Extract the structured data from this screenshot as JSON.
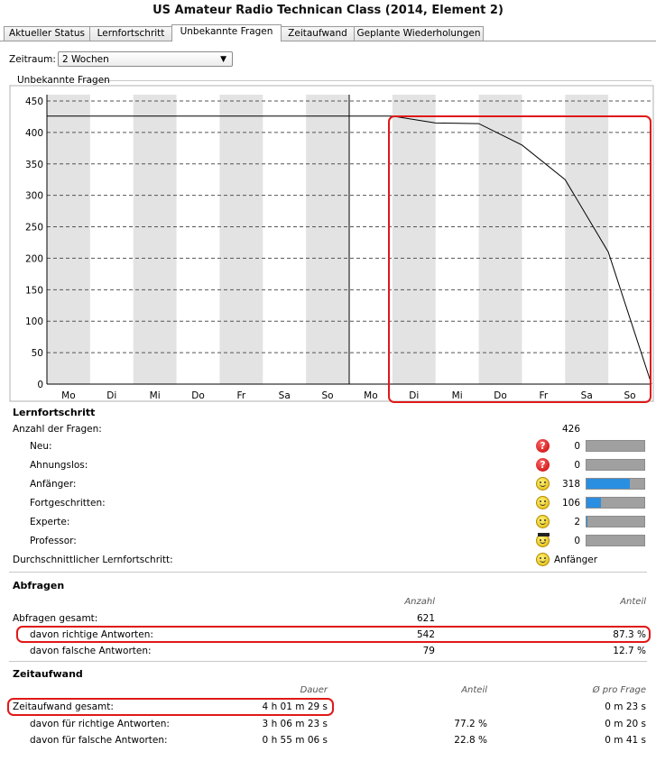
{
  "window_title": "US Amateur Radio Technican Class (2014, Element 2)",
  "tabs": [
    "Aktueller Status",
    "Lernfortschritt",
    "Unbekannte Fragen",
    "Zeitaufwand",
    "Geplante Wiederholungen"
  ],
  "active_tab": "Unbekannte Fragen",
  "period": {
    "label": "Zeitraum:",
    "value": "2 Wochen"
  },
  "chart_group_label": "Unbekannte Fragen",
  "chart_data": {
    "type": "line",
    "categories": [
      "Mo",
      "Di",
      "Mi",
      "Do",
      "Fr",
      "Sa",
      "So",
      "Mo",
      "Di",
      "Mi",
      "Do",
      "Fr",
      "Sa",
      "So"
    ],
    "x": [
      0,
      1,
      2,
      3,
      4,
      5,
      6,
      7,
      8,
      9,
      10,
      11,
      12,
      13,
      14
    ],
    "values": [
      426,
      426,
      426,
      426,
      426,
      426,
      426,
      426,
      426,
      415,
      414,
      380,
      325,
      210,
      0
    ],
    "y_ticks": [
      0,
      50,
      100,
      150,
      200,
      250,
      300,
      350,
      400,
      450
    ],
    "ylim": [
      0,
      460
    ],
    "grid": true,
    "title": "",
    "xlabel": "",
    "ylabel": ""
  },
  "lernfortschritt": {
    "header": "Lernfortschritt",
    "total_label": "Anzahl der Fragen:",
    "total": "426",
    "levels": [
      {
        "label": "Neu:",
        "icon": "red-question-icon",
        "count": "0",
        "fraction": 0
      },
      {
        "label": "Ahnungslos:",
        "icon": "red-question-smiley-icon",
        "count": "0",
        "fraction": 0
      },
      {
        "label": "Anfänger:",
        "icon": "yellow-smiley-icon",
        "count": "318",
        "fraction": 0.746
      },
      {
        "label": "Fortgeschritten:",
        "icon": "yellow-smiley-icon",
        "count": "106",
        "fraction": 0.249
      },
      {
        "label": "Experte:",
        "icon": "yellow-smiley-icon",
        "count": "2",
        "fraction": 0.005
      },
      {
        "label": "Professor:",
        "icon": "graduate-smiley-icon",
        "count": "0",
        "fraction": 0
      }
    ],
    "average_label": "Durchschnittlicher Lernfortschritt:",
    "average_value": "Anfänger"
  },
  "abfragen": {
    "header": "Abfragen",
    "col_count": "Anzahl",
    "col_share": "Anteil",
    "rows": [
      {
        "label": "Abfragen gesamt:",
        "count": "621",
        "share": ""
      },
      {
        "label": "davon richtige Antworten:",
        "count": "542",
        "share": "87.3 %"
      },
      {
        "label": "davon falsche Antworten:",
        "count": "79",
        "share": "12.7 %"
      }
    ]
  },
  "zeitaufwand": {
    "header": "Zeitaufwand",
    "col_duration": "Dauer",
    "col_share": "Anteil",
    "col_per_question": "Ø pro Frage",
    "rows": [
      {
        "label": "Zeitaufwand gesamt:",
        "duration": "4 h 01 m 29 s",
        "share": "",
        "per_question": "0 m 23 s"
      },
      {
        "label": "davon für richtige Antworten:",
        "duration": "3 h 06 m 23 s",
        "share": "77.2 %",
        "per_question": "0 m 20 s"
      },
      {
        "label": "davon für falsche Antworten:",
        "duration": "0 h 55 m 06 s",
        "share": "22.8 %",
        "per_question": "0 m 41 s"
      }
    ]
  },
  "colors": {
    "bar_fill": "#2a8fe0",
    "bar_empty": "#a0a0a0",
    "highlight": "#e01818"
  }
}
